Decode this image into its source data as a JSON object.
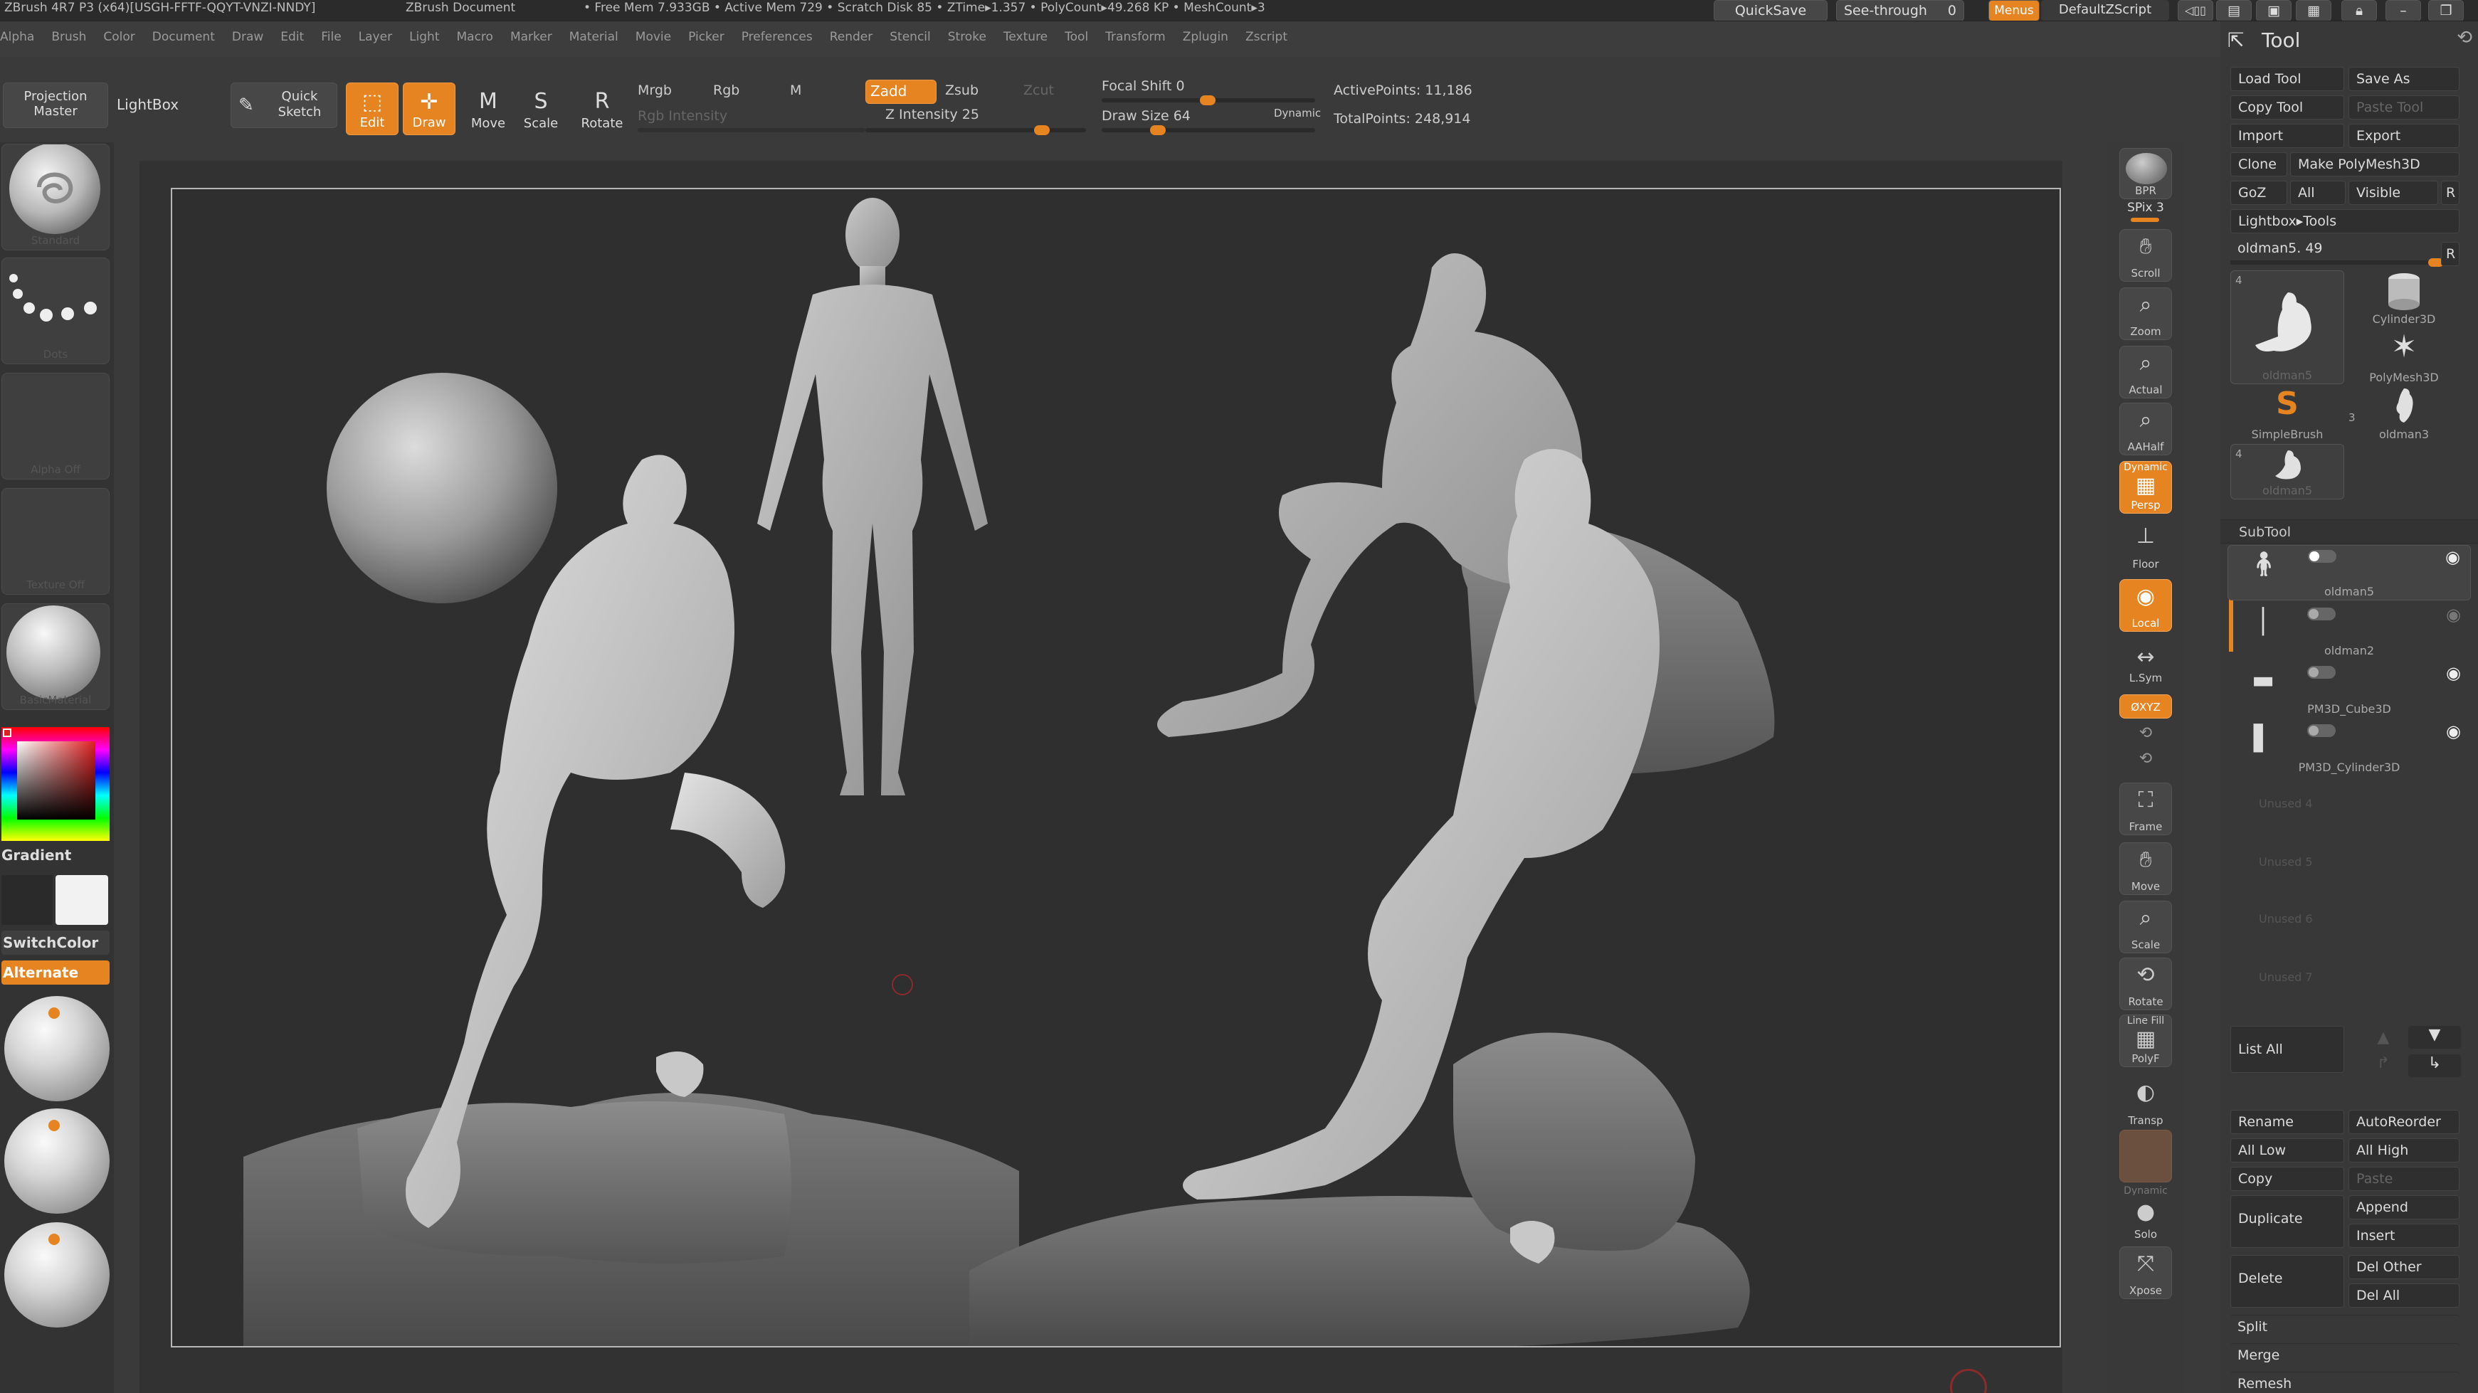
{
  "titlebar": {
    "app": "ZBrush 4R7 P3 (x64)[USGH-FFTF-QQYT-VNZI-NNDY]",
    "doc": "ZBrush Document",
    "stats": "• Free Mem 7.933GB • Active Mem 729 • Scratch Disk 85 • ZTime▸1.357 • PolyCount▸49.268 KP • MeshCount▸3",
    "quicksave": "QuickSave",
    "seethrough": "See-through",
    "seethrough_value": "0",
    "menus": "Menus",
    "script": "DefaultZScript"
  },
  "menubar": {
    "items": [
      "Alpha",
      "Brush",
      "Color",
      "Document",
      "Draw",
      "Edit",
      "File",
      "Layer",
      "Light",
      "Macro",
      "Marker",
      "Material",
      "Movie",
      "Picker",
      "Preferences",
      "Render",
      "Stencil",
      "Stroke",
      "Texture",
      "Tool",
      "Transform",
      "Zplugin",
      "Zscript"
    ]
  },
  "shelf": {
    "projection_master": "Projection Master",
    "lightbox": "LightBox",
    "quick_sketch": "Quick Sketch",
    "edit": "Edit",
    "draw": "Draw",
    "move": "Move",
    "scale": "Scale",
    "rotate": "Rotate",
    "mrgb": "Mrgb",
    "rgb": "Rgb",
    "m": "M",
    "rgb_intensity": "Rgb Intensity",
    "zadd": "Zadd",
    "zsub": "Zsub",
    "zcut": "Zcut",
    "z_intensity": "Z Intensity 25",
    "focal_shift": "Focal Shift 0",
    "draw_size": "Draw Size 64",
    "dynamic": "Dynamic",
    "active_points": "ActivePoints: 11,186",
    "total_points": "TotalPoints: 248,914",
    "z_intensity_value": 25,
    "z_intensity_max": 100,
    "focal_shift_value": 0,
    "draw_size_value": 64
  },
  "leftpanel": {
    "brush_caption": "Standard",
    "stroke_caption": "Dots",
    "alpha_caption": "Alpha Off",
    "texture_caption": "Texture Off",
    "material_caption": "BasicMaterial",
    "gradient": "Gradient",
    "switchcolor": "SwitchColor",
    "alternate": "Alternate"
  },
  "rightshelf": {
    "bpr": "BPR",
    "spix": "SPix 3",
    "scroll": "Scroll",
    "zoom": "Zoom",
    "actual": "Actual",
    "aahalf": "AAHalf",
    "dynamic": "Dynamic",
    "persp": "Persp",
    "floor": "Floor",
    "local": "Local",
    "lsym": "L.Sym",
    "xyz": "ØXYZ",
    "frame": "Frame",
    "move": "Move",
    "scale": "Scale",
    "rotate": "Rotate",
    "linefill": "Line Fill",
    "polyf": "PolyF",
    "transp": "Transp",
    "dynamic2": "Dynamic",
    "solo": "Solo",
    "xpose": "Xpose"
  },
  "toolpanel": {
    "title": "Tool",
    "load_tool": "Load Tool",
    "save_as": "Save As",
    "copy_tool": "Copy Tool",
    "paste_tool": "Paste Tool",
    "import": "Import",
    "export": "Export",
    "clone": "Clone",
    "make_polymesh": "Make PolyMesh3D",
    "goz": "GoZ",
    "all": "All",
    "visible": "Visible",
    "r": "R",
    "lightbox_tools": "Lightbox▸Tools",
    "current_tool": "oldman5. 49",
    "thumbs": [
      {
        "name": "oldman5",
        "count": "4"
      },
      {
        "name": "Cylinder3D",
        "count": ""
      },
      {
        "name": "PolyMesh3D",
        "count": ""
      },
      {
        "name": "SimpleBrush",
        "count": ""
      },
      {
        "name": "oldman3",
        "count": "3"
      },
      {
        "name": "oldman5",
        "count": "4"
      }
    ],
    "subtool_title": "SubTool",
    "subtools": [
      "oldman5",
      "oldman2",
      "PM3D_Cube3D",
      "PM3D_Cylinder3D"
    ],
    "unused": [
      "Unused 4",
      "Unused 5",
      "Unused 6",
      "Unused 7"
    ],
    "list_all": "List All",
    "rename": "Rename",
    "autoreorder": "AutoReorder",
    "all_low": "All Low",
    "all_high": "All High",
    "copy": "Copy",
    "paste": "Paste",
    "duplicate": "Duplicate",
    "append": "Append",
    "insert": "Insert",
    "delete": "Delete",
    "del_other": "Del Other",
    "del_all": "Del All",
    "split": "Split",
    "merge": "Merge",
    "remesh": "Remesh"
  },
  "colors": {
    "accent": "#e58421",
    "background": "#3a3a3a",
    "document": "#2f2f2f"
  }
}
